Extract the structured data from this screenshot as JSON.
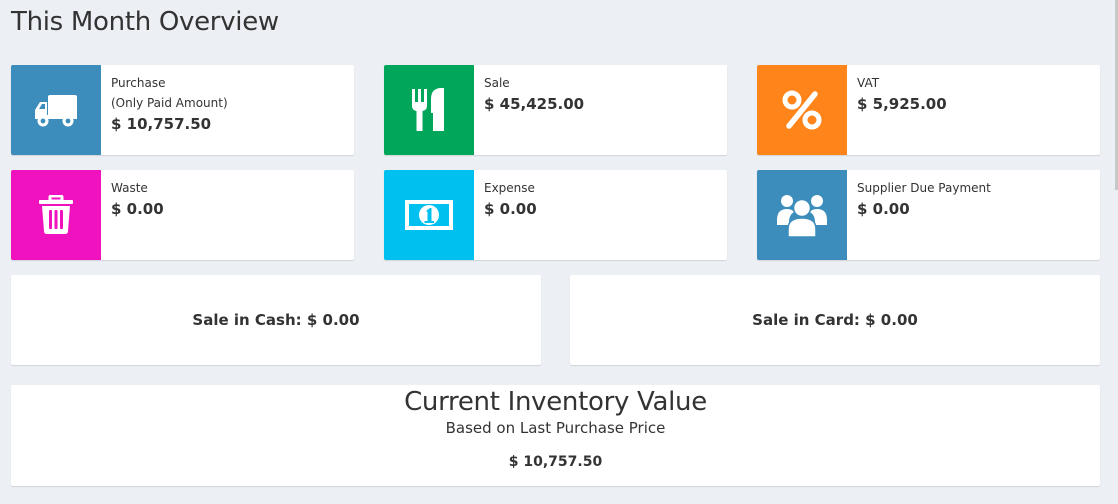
{
  "page": {
    "title": "This Month Overview"
  },
  "info_boxes": [
    {
      "label": "Purchase",
      "sublabel": "(Only Paid Amount)",
      "value": "$ 10,757.50",
      "icon": "truck-icon",
      "color": "#3c8dbc"
    },
    {
      "label": "Sale",
      "value": "$ 45,425.00",
      "icon": "fork-knife-icon",
      "color": "#00a65a"
    },
    {
      "label": "VAT",
      "value": "$ 5,925.00",
      "icon": "percent-icon",
      "color": "#ff851b"
    },
    {
      "label": "Waste",
      "value": "$ 0.00",
      "icon": "trash-icon",
      "color": "#f012be"
    },
    {
      "label": "Expense",
      "value": "$ 0.00",
      "icon": "money-bill-icon",
      "color": "#00c0ef"
    },
    {
      "label": "Supplier Due Payment",
      "value": "$ 0.00",
      "icon": "users-icon",
      "color": "#3c8dbc"
    }
  ],
  "sale_cash": "Sale in Cash: $ 0.00",
  "sale_card": "Sale in Card: $ 0.00",
  "inventory": {
    "title": "Current Inventory Value",
    "subtitle": "Based on Last Purchase Price",
    "value": "$ 10,757.50"
  }
}
